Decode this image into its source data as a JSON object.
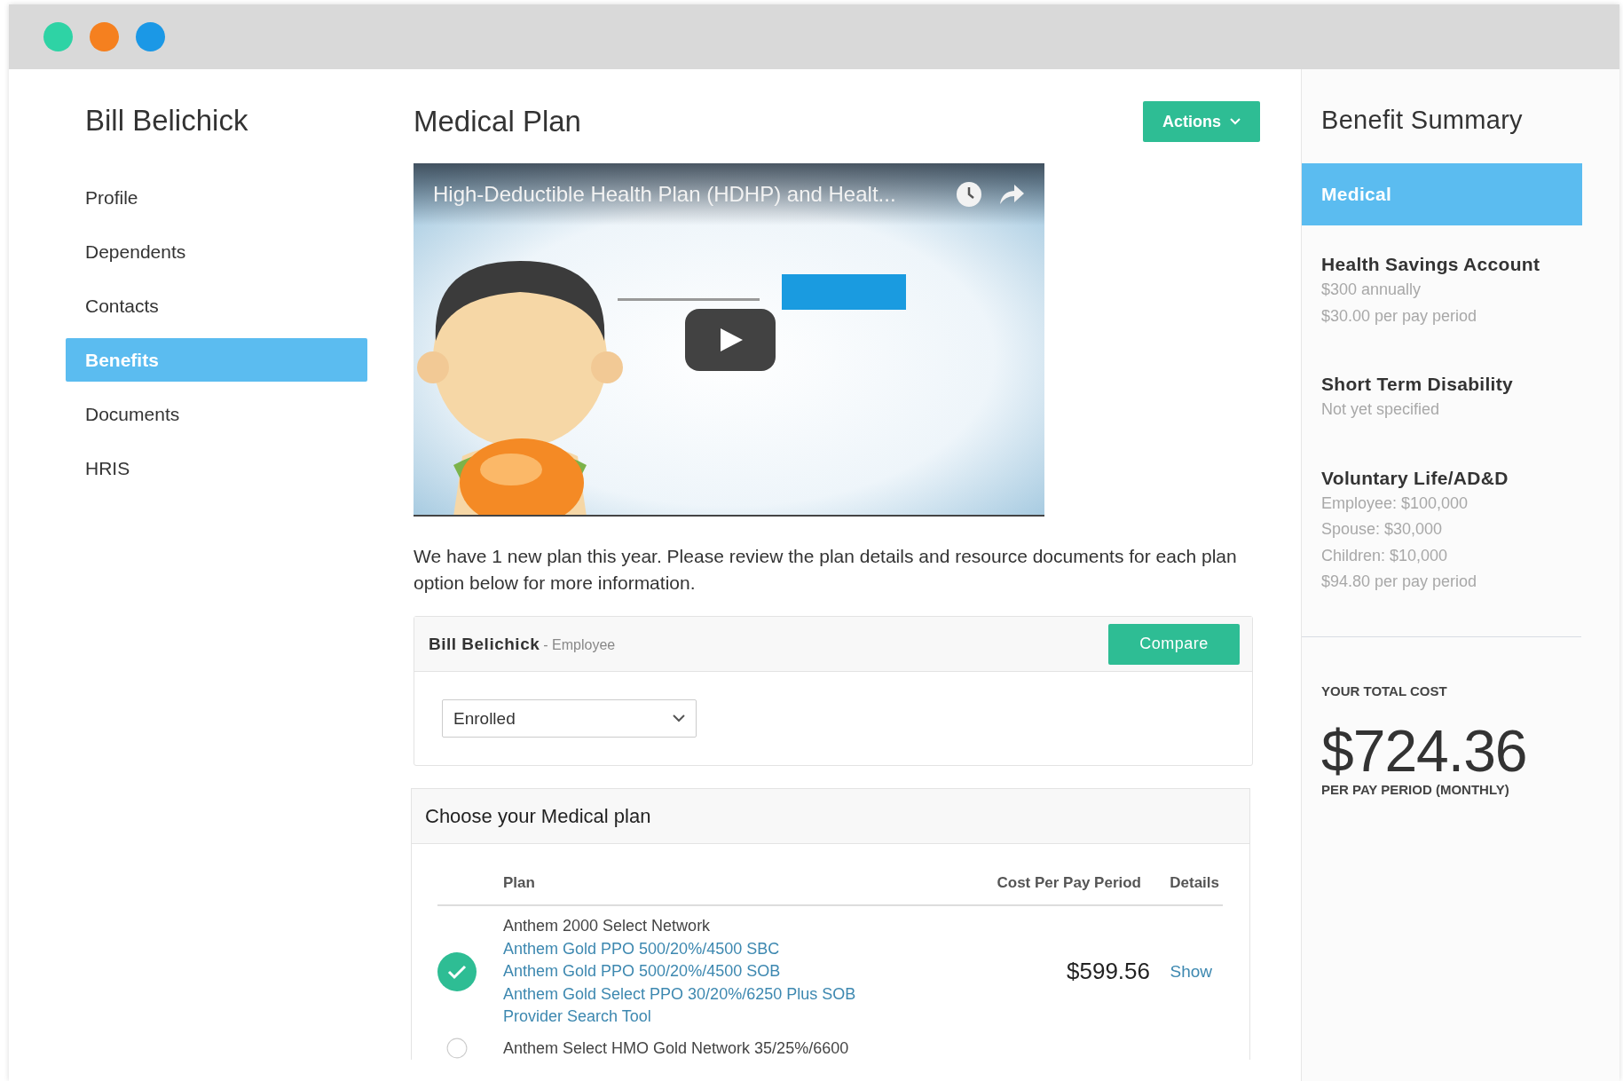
{
  "window": {
    "controls": [
      {
        "color": "#2ed3a5"
      },
      {
        "color": "#f5801f"
      },
      {
        "color": "#1b98e6"
      }
    ]
  },
  "sidebar": {
    "user_name": "Bill Belichick",
    "items": [
      {
        "label": "Profile",
        "selected": false
      },
      {
        "label": "Dependents",
        "selected": false
      },
      {
        "label": "Contacts",
        "selected": false
      },
      {
        "label": "Benefits",
        "selected": true
      },
      {
        "label": "Documents",
        "selected": false
      },
      {
        "label": "HRIS",
        "selected": false
      }
    ]
  },
  "main": {
    "title": "Medical Plan",
    "actions_button": "Actions",
    "video": {
      "title": "High-Deductible Health Plan (HDHP) and Healt..."
    },
    "intro": "We have 1 new plan this year. Please review the plan details and resource documents for each plan option below for more information.",
    "employee_card": {
      "name": "Bill Belichick",
      "role": "- Employee",
      "compare_button": "Compare",
      "status_select": {
        "value": "Enrolled"
      }
    },
    "plan_card": {
      "title": "Choose your Medical plan",
      "columns": [
        "Plan",
        "Cost Per Pay Period",
        "Details"
      ],
      "rows": [
        {
          "selected": true,
          "plan_name": "Anthem 2000 Select Network",
          "links": [
            "Anthem Gold PPO 500/20%/4500 SBC",
            "Anthem Gold PPO 500/20%/4500 SOB",
            "Anthem Gold Select PPO 30/20%/6250 Plus SOB",
            "Provider Search Tool"
          ],
          "cost": "$599.56",
          "details_link": "Show"
        },
        {
          "selected": false,
          "plan_name": "Anthem Select HMO Gold Network 35/25%/6600"
        }
      ]
    }
  },
  "summary": {
    "title": "Benefit Summary",
    "items": [
      {
        "name": "Medical",
        "selected": true
      },
      {
        "name": "Health Savings Account",
        "selected": false,
        "details": [
          "$300 annually",
          "$30.00 per pay period"
        ]
      },
      {
        "name": "Short Term Disability",
        "selected": false,
        "details": [
          "Not yet specified"
        ]
      },
      {
        "name": "Voluntary Life/AD&D",
        "selected": false,
        "details": [
          "Employee: $100,000",
          "Spouse: $30,000",
          "Children: $10,000",
          "$94.80 per pay period"
        ]
      }
    ],
    "total": {
      "label": "YOUR TOTAL COST",
      "amount": "$724.36",
      "period": "PER PAY PERIOD (MONTHLY)"
    }
  }
}
